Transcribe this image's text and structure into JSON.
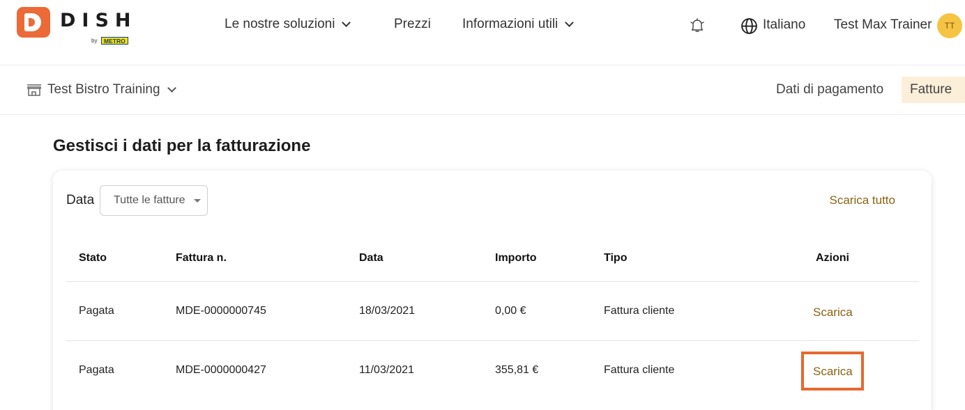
{
  "brand": {
    "name": "DISH",
    "by": "by",
    "partner": "METRO",
    "accent": "#ec6a37"
  },
  "topnav": {
    "items": [
      {
        "label": "Le nostre soluzioni",
        "dropdown": true
      },
      {
        "label": "Prezzi",
        "dropdown": false
      },
      {
        "label": "Informazioni utili",
        "dropdown": true
      }
    ],
    "icons": {
      "notifications": "bell-icon",
      "language": "globe-icon"
    },
    "language": "Italiano",
    "user_name": "Test Max Trainer",
    "user_initials": "TT"
  },
  "subbar": {
    "store": "Test Bistro Training",
    "tabs": [
      {
        "label": "Dati di pagamento",
        "active": false
      },
      {
        "label": "Fatture",
        "active": true
      }
    ]
  },
  "page": {
    "title": "Gestisci i dati per la fatturazione"
  },
  "filter": {
    "label": "Data",
    "selected": "Tutte le fatture"
  },
  "download_all": "Scarica tutto",
  "table": {
    "headers": [
      "Stato",
      "Fattura n.",
      "Data",
      "Importo",
      "Tipo",
      "Azioni"
    ],
    "rows": [
      {
        "status": "Pagata",
        "number": "MDE-0000000745",
        "date": "18/03/2021",
        "amount": "0,00 €",
        "type": "Fattura cliente",
        "action": "Scarica"
      },
      {
        "status": "Pagata",
        "number": "MDE-0000000427",
        "date": "11/03/2021",
        "amount": "355,81 €",
        "type": "Fattura cliente",
        "action": "Scarica"
      }
    ]
  },
  "colors": {
    "link": "#8a6212",
    "highlight": "#e8682f",
    "active_tab": "#fcefd9",
    "avatar": "#f6c445"
  }
}
